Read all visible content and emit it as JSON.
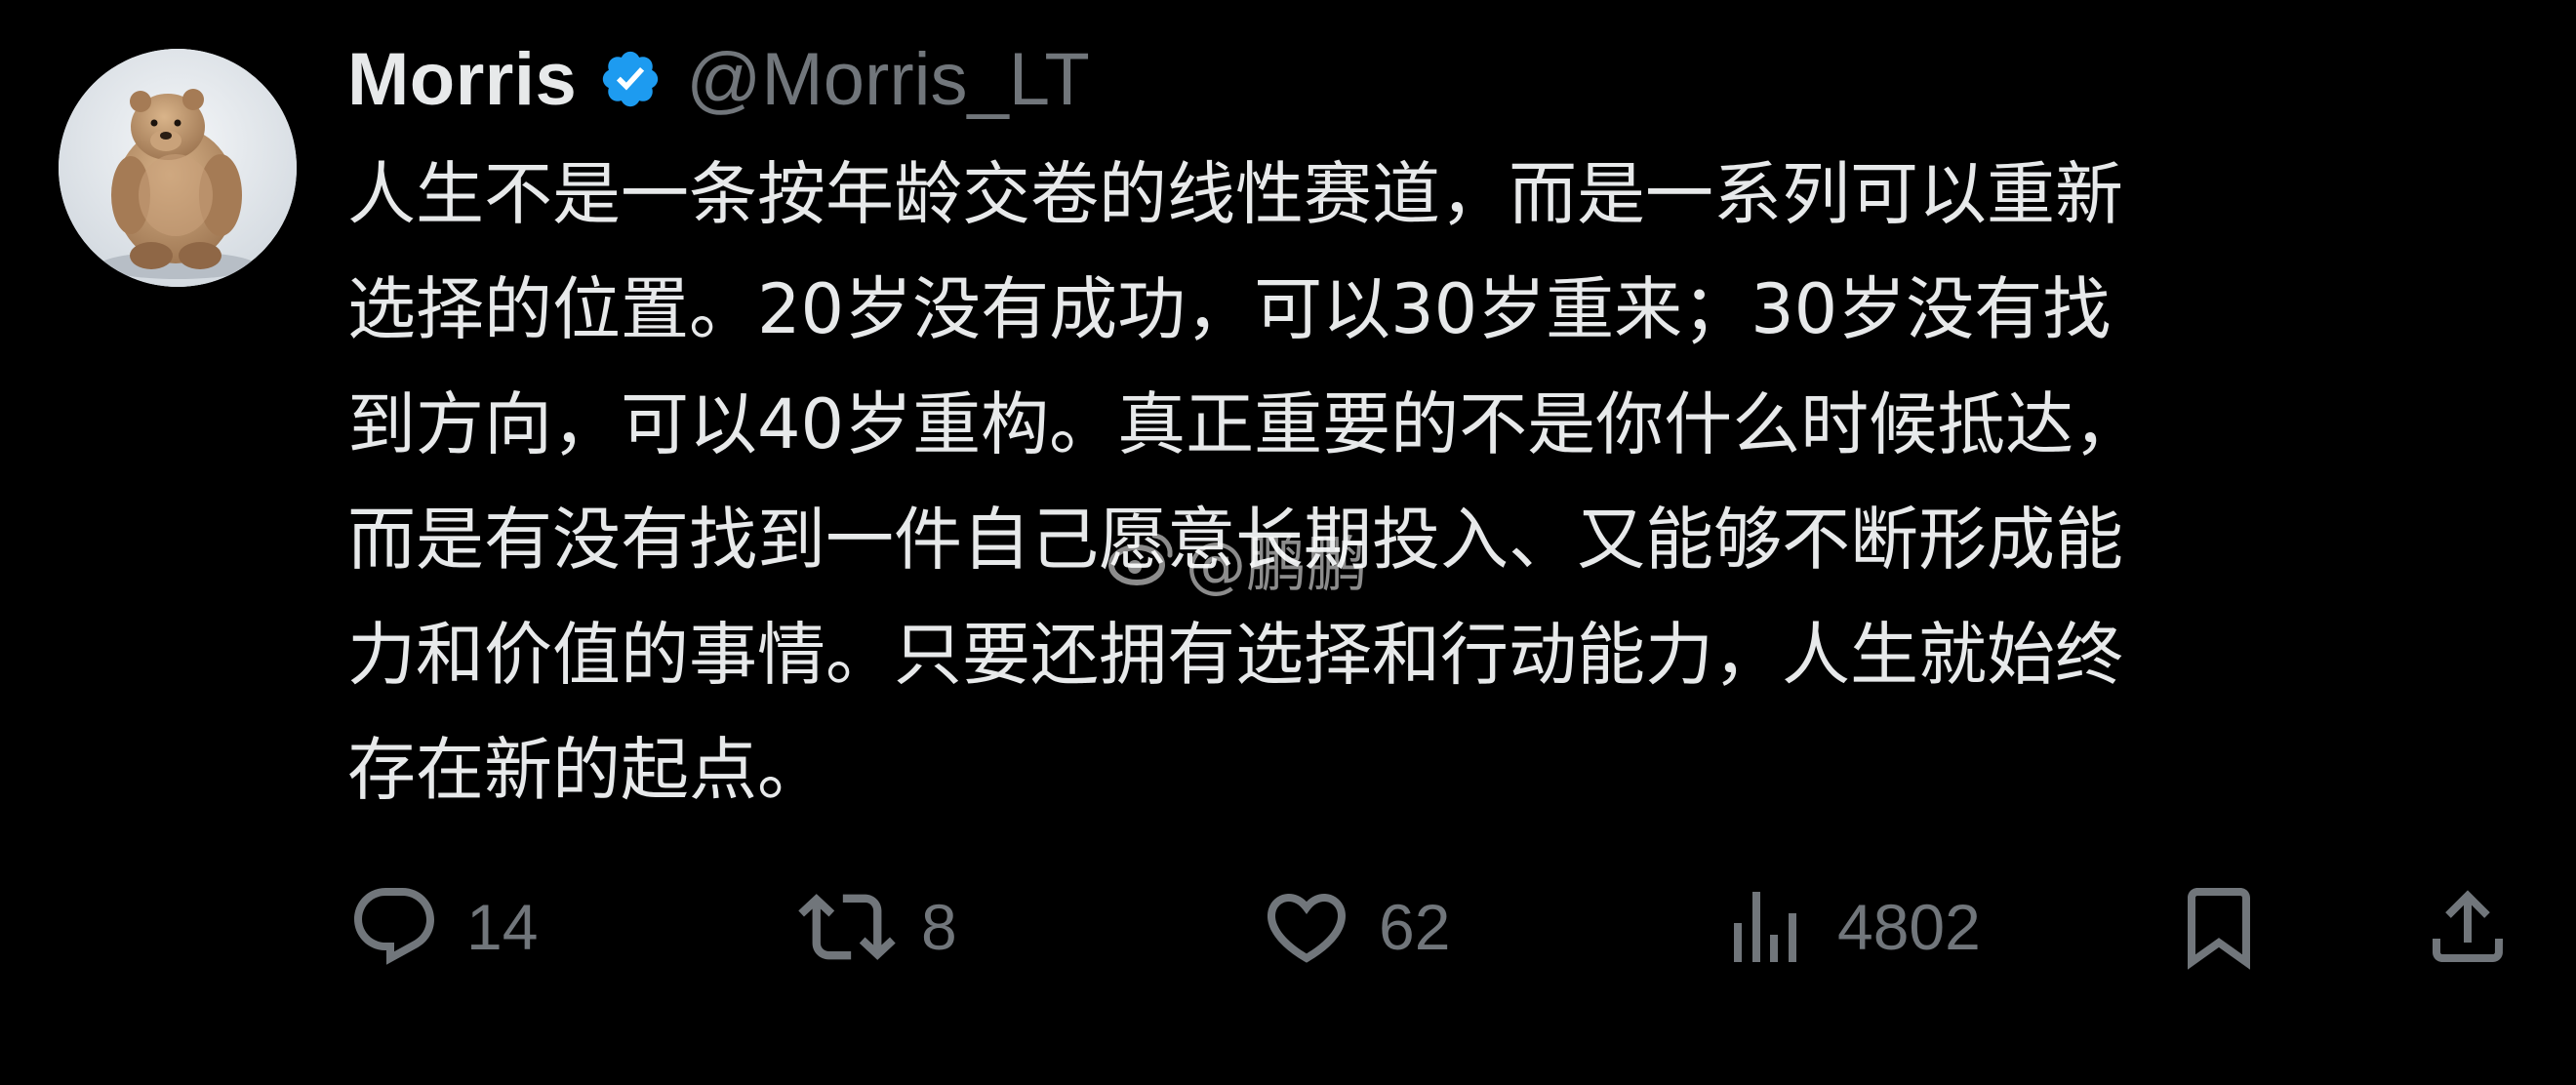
{
  "post": {
    "author": {
      "display_name": "Morris",
      "handle": "@Morris_LT",
      "verified": true,
      "verified_color": "#1d9bf0",
      "avatar_icon": "bear-avatar"
    },
    "text_lines": [
      "人生不是一条按年龄交卷的线性赛道，而是一系列可以重新",
      "选择的位置。20岁没有成功，可以30岁重来；30岁没有找",
      "到方向，可以40岁重构。真正重要的不是你什么时候抵达，",
      "而是有没有找到一件自己愿意长期投入、又能够不断形成能",
      "力和价值的事情。只要还拥有选择和行动能力，人生就始终",
      "存在新的起点。"
    ],
    "watermark": "@鹏鹏"
  },
  "actions": {
    "reply": {
      "icon": "reply-icon",
      "count": "14"
    },
    "retweet": {
      "icon": "retweet-icon",
      "count": "8"
    },
    "like": {
      "icon": "heart-icon",
      "count": "62"
    },
    "views": {
      "icon": "views-chart-icon",
      "count": "4802"
    },
    "bookmark": {
      "icon": "bookmark-icon"
    },
    "share": {
      "icon": "share-icon"
    }
  },
  "colors": {
    "background": "#000000",
    "text": "#e7e9ea",
    "muted": "#71767b"
  }
}
